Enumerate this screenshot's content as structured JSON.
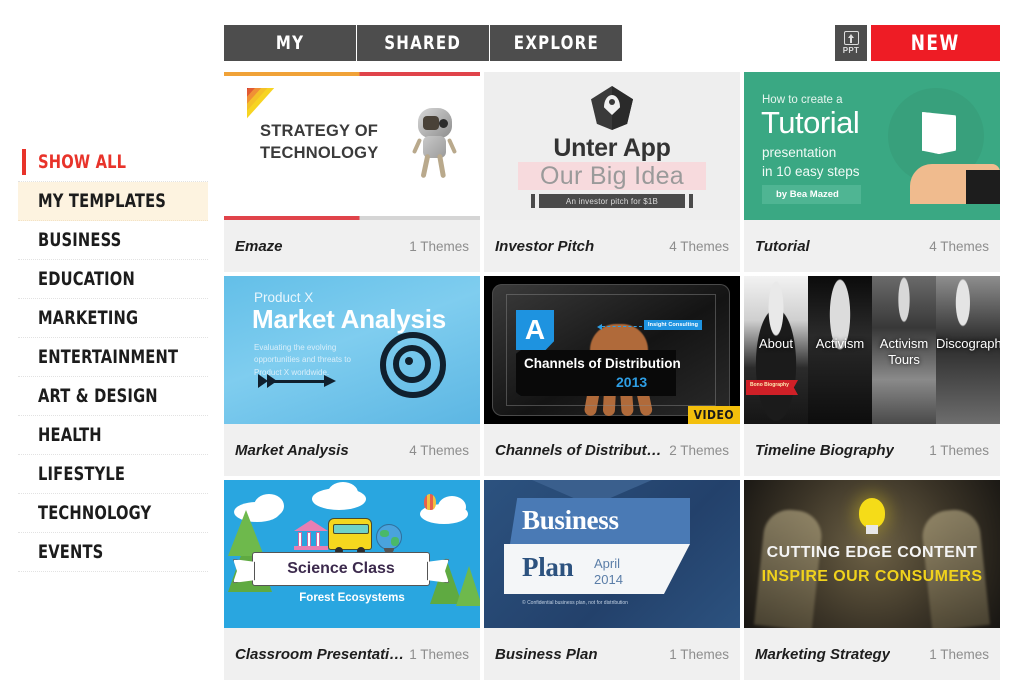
{
  "topbar": {
    "tabs": [
      {
        "id": "my",
        "label": "MY",
        "active": true
      },
      {
        "id": "shared",
        "label": "SHARED",
        "active": false
      },
      {
        "id": "explore",
        "label": "EXPLORE",
        "active": false
      }
    ],
    "ppt_button": {
      "label": "PPT",
      "icon": "upload-box-icon"
    },
    "new_button": {
      "label": "NEW",
      "color": "#ee1c25"
    }
  },
  "sidebar": {
    "items": [
      {
        "label": "SHOW ALL",
        "state": "active"
      },
      {
        "label": "MY TEMPLATES",
        "state": "highlight"
      },
      {
        "label": "BUSINESS",
        "state": "normal"
      },
      {
        "label": "EDUCATION",
        "state": "normal"
      },
      {
        "label": "MARKETING",
        "state": "normal"
      },
      {
        "label": "ENTERTAINMENT",
        "state": "normal"
      },
      {
        "label": "ART & DESIGN",
        "state": "normal"
      },
      {
        "label": "HEALTH",
        "state": "normal"
      },
      {
        "label": "LIFESTYLE",
        "state": "normal"
      },
      {
        "label": "TECHNOLOGY",
        "state": "normal"
      },
      {
        "label": "EVENTS",
        "state": "normal"
      }
    ],
    "accent_color": "#e8332a",
    "highlight_color": "#fdf3e0"
  },
  "cards": [
    {
      "id": "emaze",
      "title": "Emaze",
      "themes": "1 Themes",
      "badge": null,
      "preview": {
        "headline_line1": "STRATEGY OF",
        "headline_line2": "TECHNOLOGY",
        "stripe_colors": [
          "#6e3332",
          "#a52a2e",
          "#cc3b33",
          "#e25b33",
          "#f09035",
          "#f4c128",
          "#f7d422"
        ],
        "top_bar_colors": [
          "#f0a238",
          "#e0434a"
        ],
        "bottom_bar_colors": [
          "#e0434a",
          "#d5d5d5"
        ],
        "figure": "robot-mascot"
      }
    },
    {
      "id": "investor-pitch",
      "title": "Investor Pitch",
      "themes": "4 Themes",
      "badge": null,
      "preview": {
        "logo": "map-pin-rock-icon",
        "title": "Unter App",
        "subtitle": "Our Big Idea",
        "tagline": "An investor pitch for $1B",
        "highlight_color": "#f7dadd",
        "background": "#eeeeee"
      }
    },
    {
      "id": "tutorial",
      "title": "Tutorial",
      "themes": "4 Themes",
      "badge": null,
      "preview": {
        "kicker": "How to create a",
        "title": "Tutorial",
        "line2": "presentation",
        "line3": "in 10 easy steps",
        "author": "by Bea Mazed",
        "background": "#3aa883",
        "figure": "book-in-hand-icon"
      }
    },
    {
      "id": "market-analysis",
      "title": "Market Analysis",
      "themes": "4 Themes",
      "badge": null,
      "preview": {
        "kicker": "Product X",
        "title": "Market Analysis",
        "body": "Evaluating the evolving opportunities and threats to Product X worldwide.",
        "background": "#63bfe8",
        "figures": [
          "arrow-icon",
          "target-bullseye-icon"
        ]
      }
    },
    {
      "id": "channels-of-distribution",
      "title": "Channels of Distribut…",
      "themes": "2 Themes",
      "badge": "VIDEO",
      "preview": {
        "letter_badge": "A",
        "title": "Channels of Distribution",
        "year": "2013",
        "sublabel": "Insight Consulting",
        "background": "#000000",
        "figure": "tablet-with-hand"
      }
    },
    {
      "id": "timeline-biography",
      "title": "Timeline Biography",
      "themes": "1 Themes",
      "badge": null,
      "preview": {
        "panels": [
          "About",
          "Activism",
          "Activism Tours",
          "Discography"
        ],
        "ribbon": "Bono Biography",
        "style": "black-and-white-photo-strip"
      }
    },
    {
      "id": "classroom-presentation",
      "title": "Classroom Presentation",
      "themes": "1 Themes",
      "badge": null,
      "preview": {
        "banner": "Science Class",
        "subtitle": "Forest Ecosystems",
        "background": "#29a6e0",
        "figures": [
          "school-building-icon",
          "school-bus-icon",
          "globe-icon",
          "hot-air-balloon-icon",
          "cloud-icon",
          "pine-tree-icon"
        ]
      }
    },
    {
      "id": "business-plan",
      "title": "Business Plan",
      "themes": "1 Themes",
      "badge": null,
      "preview": {
        "line1": "Business",
        "line2": "Plan",
        "month": "April",
        "year": "2014",
        "note": "© Confidential business plan, not for distribution",
        "background": "#274a7a"
      }
    },
    {
      "id": "marketing-strategy",
      "title": "Marketing Strategy",
      "themes": "1 Themes",
      "badge": null,
      "preview": {
        "line1": "CUTTING EDGE CONTENT",
        "line2": "INSPIRE OUR CONSUMERS",
        "line2_color": "#f0d21c",
        "figure": "lightbulb-icon"
      }
    }
  ]
}
